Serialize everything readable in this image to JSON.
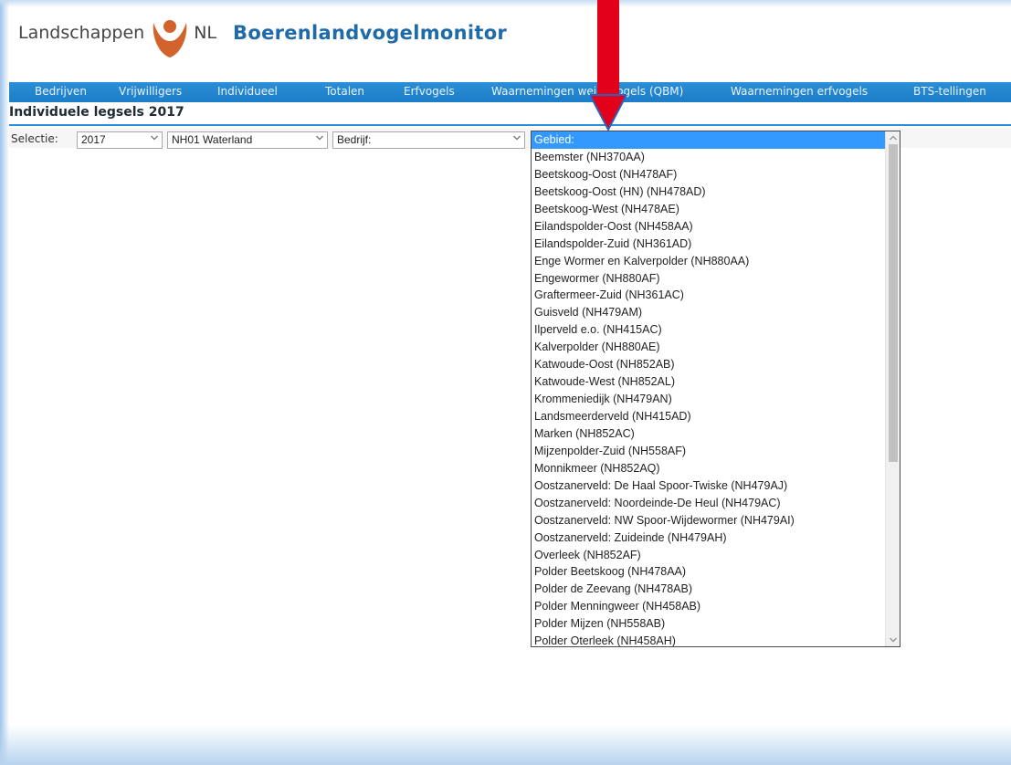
{
  "header": {
    "logo_left": "Landschappen",
    "logo_right": "NL",
    "app_title": "Boerenlandvogelmonitor"
  },
  "nav": {
    "items": [
      "Bedrijven",
      "Vrijwilligers",
      "Individueel",
      "Totalen",
      "Erfvogels",
      "Waarnemingen weidevogels (QBM)",
      "Waarnemingen erfvogels",
      "BTS-tellingen"
    ]
  },
  "main": {
    "heading": "Individuele legsels 2017",
    "selectie_label": "Selectie:",
    "year_value": "2017",
    "region_value": "NH01 Waterland",
    "bedrijf_value": "Bedrijf:"
  },
  "dropdown": {
    "selected": "Gebied:",
    "options": [
      "Beemster (NH370AA)",
      "Beetskoog-Oost (NH478AF)",
      "Beetskoog-Oost (HN) (NH478AD)",
      "Beetskoog-West (NH478AE)",
      "Eilandspolder-Oost (NH458AA)",
      "Eilandspolder-Zuid (NH361AD)",
      "Enge Wormer en Kalverpolder (NH880AA)",
      "Engewormer (NH880AF)",
      "Graftermeer-Zuid (NH361AC)",
      "Guisveld (NH479AM)",
      "Ilperveld e.o. (NH415AC)",
      "Kalverpolder (NH880AE)",
      "Katwoude-Oost (NH852AB)",
      "Katwoude-West (NH852AL)",
      "Krommeniedijk (NH479AN)",
      "Landsmeerderveld (NH415AD)",
      "Marken (NH852AC)",
      "Mijzenpolder-Zuid (NH558AF)",
      "Monnikmeer (NH852AQ)",
      "Oostzanerveld: De Haal Spoor-Twiske (NH479AJ)",
      "Oostzanerveld: Noordeinde-De Heul (NH479AC)",
      "Oostzanerveld: NW Spoor-Wijdewormer (NH479AI)",
      "Oostzanerveld: Zuideinde (NH479AH)",
      "Overleek (NH852AF)",
      "Polder Beetskoog (NH478AA)",
      "Polder de Zeevang (NH478AB)",
      "Polder Menningweer (NH458AB)",
      "Polder Mijzen (NH558AB)",
      "Polder Oterleek (NH458AH)"
    ]
  },
  "colors": {
    "nav_bg": "#1d7dc8",
    "title_blue": "#1f6aa8",
    "logo_orange": "#d2632c",
    "annotation_red": "#e3001b",
    "selected_bg": "#3399ff"
  },
  "icons": {
    "logo": "landschappen-logo-icon",
    "annotation": "red-arrow-icon",
    "select_chevron": "chevron-down-icon"
  }
}
